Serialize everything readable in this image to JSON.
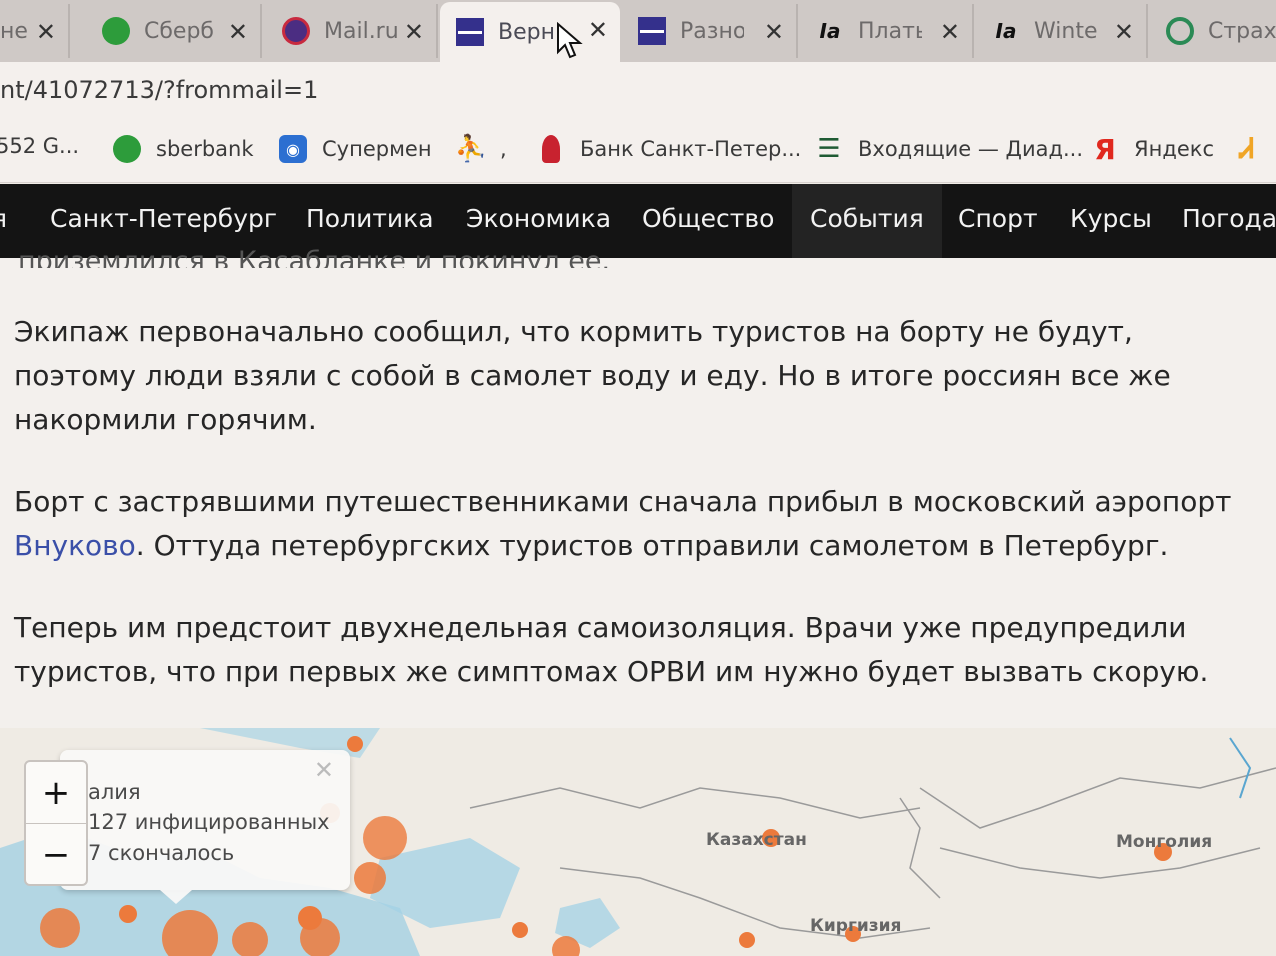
{
  "tabs": [
    {
      "title": "не",
      "icon": "doc-icon",
      "active": false
    },
    {
      "title": "Сберб",
      "icon": "sberbank-icon",
      "active": false
    },
    {
      "title": "Mail.ru",
      "icon": "mail-ru-icon",
      "active": false
    },
    {
      "title": "Верн",
      "icon": "news-doc-icon",
      "active": true
    },
    {
      "title": "Разно",
      "icon": "news-doc-icon",
      "active": false
    },
    {
      "title": "Плать",
      "icon": "ia-icon",
      "active": false
    },
    {
      "title": "Winte",
      "icon": "ia-icon",
      "active": false
    },
    {
      "title": "Страх",
      "icon": "refresh-green-icon",
      "active": false
    }
  ],
  "tab_close_glyph": "✕",
  "address": {
    "url": "nt/41072713/?frommail=1"
  },
  "bookmarks": [
    {
      "label": "552 G...",
      "icon": "none"
    },
    {
      "label": "sberbank",
      "icon": "sberbank-icon"
    },
    {
      "label": "Супермен",
      "icon": "superman-icon"
    },
    {
      "label": ",",
      "icon": "runner-icon"
    },
    {
      "label": "Банк Санкт-Петер...",
      "icon": "bank-spb-icon"
    },
    {
      "label": "Входящие — Диад...",
      "icon": "diadoc-icon"
    },
    {
      "label": "Яндекс",
      "icon": "yandex-icon"
    }
  ],
  "site_nav": [
    "я",
    "Санкт-Петербург",
    "Политика",
    "Экономика",
    "Общество",
    "События",
    "Спорт",
    "Курсы",
    "Погода"
  ],
  "article": {
    "peek_line": "приземлился в Касабланке и покинул ее.",
    "p1": "Экипаж первоначально сообщил, что кормить туристов на борту не будут, поэтому люди взяли с собой в самолет воду и еду. Но в итоге россиян все же накормили горячим.",
    "p2_before": "Борт с застрявшими путешественниками сначала прибыл в московский аэропорт ",
    "p2_link": "Внуково",
    "p2_after": ". Оттуда петербургских туристов отправили самолетом в Петербург.",
    "p3": "Теперь им предстоит двухнедельная самоизоляция. Врачи уже предупредили туристов, что при первых же симптомах ОРВИ им нужно будет вызвать скорую."
  },
  "map": {
    "zoom_in": "+",
    "zoom_out": "−",
    "popup_line1": "алия",
    "popup_line2": "127 инфицированных",
    "popup_line3": "7 скончалось",
    "popup_close": "✕",
    "labels": {
      "kazakhstan": "Казахстан",
      "mongolia": "Монголия",
      "kyrgyzstan": "Киргизия"
    },
    "marker_color": "#ec7a3c"
  }
}
